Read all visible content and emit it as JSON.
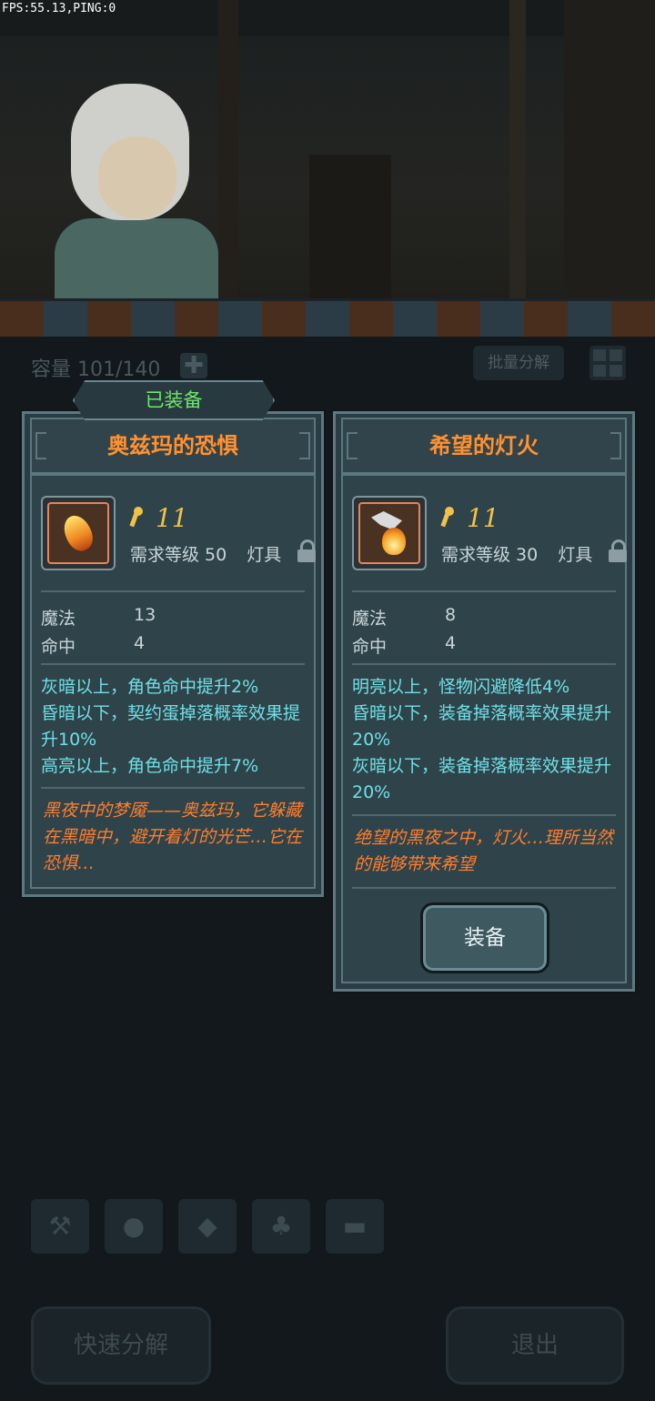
{
  "hud": {
    "fps": "FPS:55.13,PING:0"
  },
  "inventory": {
    "capacity": "容量 101/140",
    "add_symbol": "✚",
    "batch_label": "批量分解"
  },
  "equipped_tag": "已装备",
  "cards": {
    "left": {
      "name": "奥兹玛的恐惧",
      "power": "11",
      "requirement": "需求等级 50",
      "type": "灯具",
      "stats": [
        {
          "name": "魔法",
          "value": "13"
        },
        {
          "name": "命中",
          "value": "4"
        }
      ],
      "effects": [
        "灰暗以上，角色命中提升2%",
        "昏暗以下，契约蛋掉落概率效果提升10%",
        "高亮以上，角色命中提升7%"
      ],
      "flavor": "黑夜中的梦魇——奥兹玛，它躲藏在黑暗中，避开着灯的光芒…它在恐惧…"
    },
    "right": {
      "name": "希望的灯火",
      "power": "11",
      "requirement": "需求等级 30",
      "type": "灯具",
      "stats": [
        {
          "name": "魔法",
          "value": "8"
        },
        {
          "name": "命中",
          "value": "4"
        }
      ],
      "effects": [
        "明亮以上，怪物闪避降低4%",
        "昏暗以下，装备掉落概率效果提升20%",
        "灰暗以下，装备掉落概率效果提升20%"
      ],
      "flavor": "绝望的黑夜之中，灯火…理所当然的能够带来希望",
      "equip_label": "装备"
    }
  },
  "bottom": {
    "quick_decompose": "快速分解",
    "exit": "退出"
  },
  "colors": {
    "title_orange": "#ff9130",
    "effect_cyan": "#6fe0e6",
    "equipped_green": "#6ee86a",
    "power_gold": "#f2c14a"
  }
}
